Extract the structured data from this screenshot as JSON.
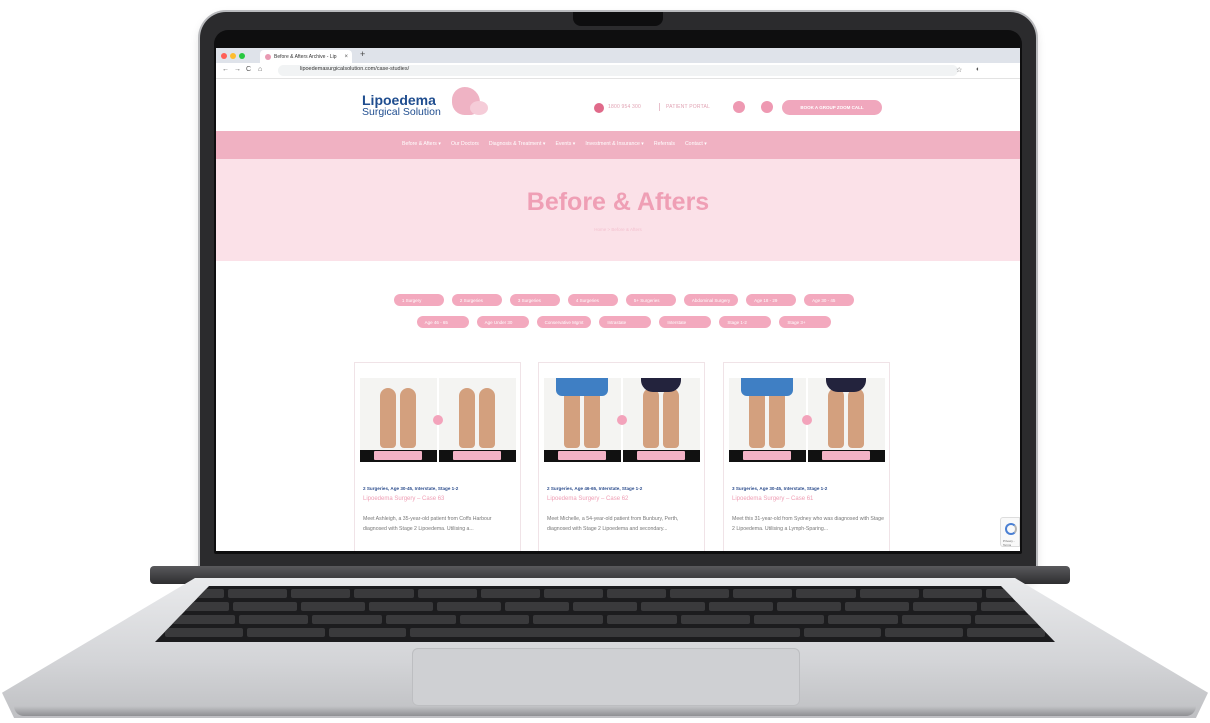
{
  "browser": {
    "tab_title": "Before & Afters Archive - Lip",
    "tab_close": "×",
    "new_tab": "+",
    "url": "lipoedemasurgicalsolution.com/case-studies/",
    "nav_back": "←",
    "nav_forward": "→",
    "nav_reload": "C",
    "nav_home": "⌂",
    "star": "☆",
    "window_buttons_colors": [
      "#ff5f57",
      "#febc2e",
      "#28c840"
    ]
  },
  "header": {
    "logo_title": "Lipoedema",
    "logo_subtitle": "Surgical Solution",
    "phone": "1800 954 300",
    "patient_portal": "PATIENT PORTAL",
    "cta": "BOOK A GROUP ZOOM CALL"
  },
  "nav": {
    "items": [
      "Before & Afters ▾",
      "Our Doctors",
      "Diagnosis & Treatment ▾",
      "Events ▾",
      "Investment & Insurance ▾",
      "Referrals",
      "Contact ▾"
    ]
  },
  "hero": {
    "title": "Before & Afters",
    "breadcrumb": "Home > Before & Afters"
  },
  "filters": {
    "row1": [
      "1 Surgery",
      "2 Surgeries",
      "3 Surgeries",
      "4 Surgeries",
      "5+ Surgeries",
      "Abdominal Surgery",
      "Age 18 - 29",
      "Age 30 - 45"
    ],
    "row2": [
      "Age 46 - 65",
      "Age Under 30",
      "Conservative Mgmt",
      "Intrastate",
      "Interstate",
      "Stage 1-2",
      "Stage 3+"
    ]
  },
  "cards": [
    {
      "meta": "2 Surgeries, Age 30-45, Interstate, Stage 1-2",
      "title": "Lipoedema Surgery – Case 63",
      "description": "Meet Ashleigh, a 35-year-old patient from Coffs Harbour diagnosed with Stage 2 Lipoedema. Utilising a..."
    },
    {
      "meta": "2 Surgeries, Age 46-65, Interstate, Stage 1-2",
      "title": "Lipoedema Surgery – Case 62",
      "description": "Meet Michelle, a 54-year-old patient from Bunbury, Perth, diagnosed with Stage 2 Lipoedema and secondary..."
    },
    {
      "meta": "3 Surgeries, Age 30-45, Interstate, Stage 1-2",
      "title": "Lipoedema Surgery – Case 61",
      "description": "Meet this 31-year-old from Sydney who was diagnosed with Stage 2 Lipoedema. Utilising a Lymph-Sparing..."
    }
  ],
  "recaptcha": {
    "label": "Privacy - Terms"
  },
  "colors": {
    "brand_pink": "#f0b1c2",
    "brand_blue": "#1f4d8f",
    "hero_bg": "#fbe1e8",
    "title_pink": "#ef9fb5"
  }
}
